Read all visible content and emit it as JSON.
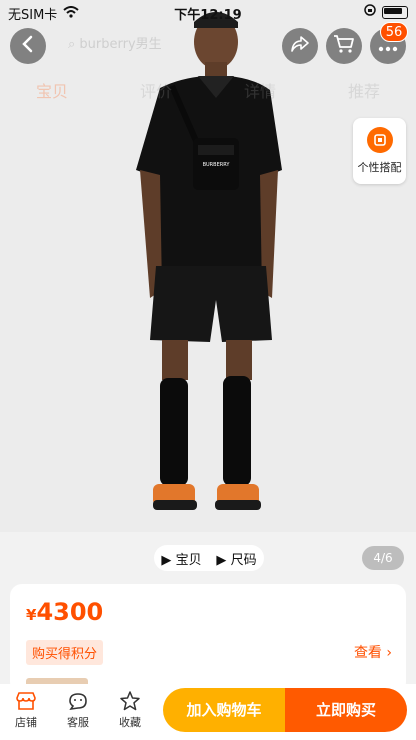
{
  "status_bar": {
    "carrier": "无SIM卡",
    "time": "下午12:19"
  },
  "header": {
    "search_placeholder": "burberry男生",
    "cart_badge": "56",
    "tabs": [
      "宝贝",
      "评价",
      "详情",
      "推荐"
    ],
    "style_match_label": "个性搭配"
  },
  "media": {
    "item_tab": "宝贝",
    "size_tab": "尺码",
    "pager": "4/6"
  },
  "product": {
    "currency": "¥",
    "price": "4300",
    "points_tag": "购买得积分",
    "view_link": "查看"
  },
  "bottom_bar": {
    "shop": "店铺",
    "service": "客服",
    "favorite": "收藏",
    "add_to_cart": "加入购物车",
    "buy_now": "立即购买"
  },
  "colors": {
    "accent": "#ff5000",
    "cart_button": "#ffb000",
    "buy_button": "#ff5a00"
  }
}
